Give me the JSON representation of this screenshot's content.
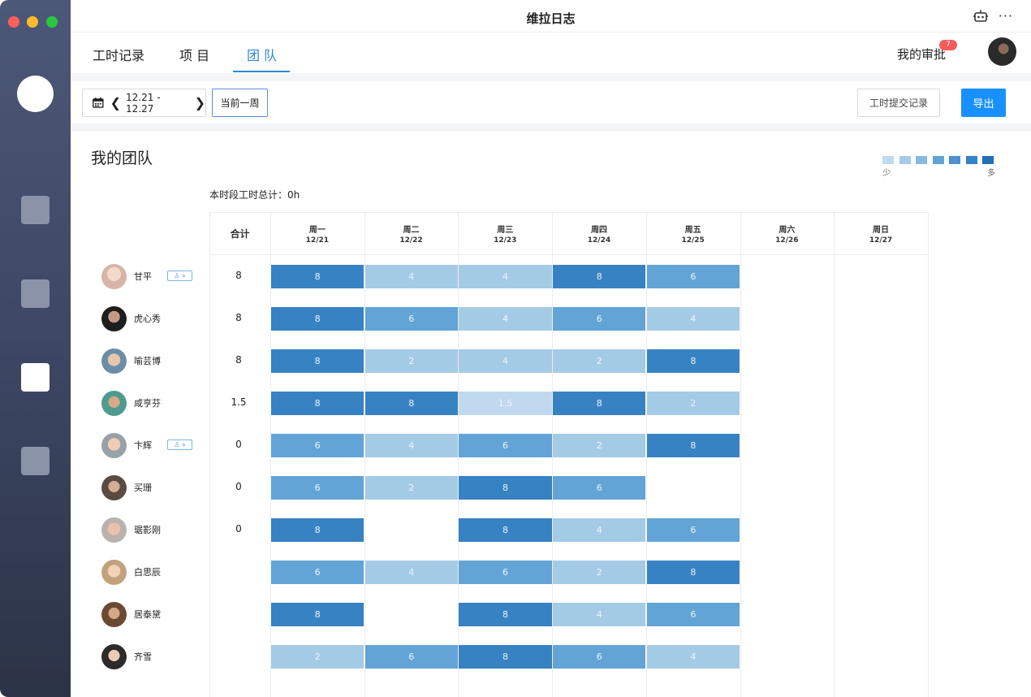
{
  "window": {
    "title": "维拉日志"
  },
  "nav": {
    "tabs": [
      {
        "label": "工时记录"
      },
      {
        "label": "项 目"
      },
      {
        "label": "团 队"
      }
    ],
    "approval_label": "我的审批",
    "approval_badge": "7"
  },
  "toolbar": {
    "date_range": "12.21 - 12.27",
    "current_week_label": "当前一周",
    "record_label": "工时提交记录",
    "export_label": "导出"
  },
  "team": {
    "title": "我的团队",
    "period_total": "本时段工时总计：0h",
    "legend": {
      "low": "少",
      "high": "多",
      "colors": [
        "#c1d9ee",
        "#a4cbe6",
        "#86bbe0",
        "#62a4d6",
        "#4b92cc",
        "#3782c2",
        "#2170b3"
      ]
    },
    "total_header": "合计",
    "days": [
      {
        "label": "周一",
        "date": "12/21"
      },
      {
        "label": "周二",
        "date": "12/22"
      },
      {
        "label": "周三",
        "date": "12/23"
      },
      {
        "label": "周四",
        "date": "12/24"
      },
      {
        "label": "周五",
        "date": "12/25"
      },
      {
        "label": "周六",
        "date": "12/26"
      },
      {
        "label": "周日",
        "date": "12/27"
      }
    ],
    "members": [
      {
        "name": "甘平",
        "total": "8",
        "tag": "♙ »",
        "hours": [
          "8",
          "4",
          "4",
          "8",
          "6",
          "",
          ""
        ]
      },
      {
        "name": "虎心秀",
        "total": "8",
        "hours": [
          "8",
          "6",
          "4",
          "6",
          "4",
          "",
          ""
        ]
      },
      {
        "name": "喻芸博",
        "total": "8",
        "hours": [
          "8",
          "2",
          "4",
          "2",
          "8",
          "",
          ""
        ]
      },
      {
        "name": "咸亨芬",
        "total": "1.5",
        "hours": [
          "8",
          "8",
          "1.5",
          "8",
          "2",
          "",
          ""
        ]
      },
      {
        "name": "卞辉",
        "total": "0",
        "tag": "♙ »",
        "hours": [
          "6",
          "4",
          "6",
          "2",
          "8",
          "",
          ""
        ]
      },
      {
        "name": "买珊",
        "total": "0",
        "hours": [
          "6",
          "2",
          "8",
          "6",
          "",
          "",
          ""
        ]
      },
      {
        "name": "琚影刚",
        "total": "0",
        "hours": [
          "8",
          "",
          "8",
          "4",
          "6",
          "",
          ""
        ]
      },
      {
        "name": "白思辰",
        "total": "",
        "hours": [
          "6",
          "4",
          "6",
          "2",
          "8",
          "",
          ""
        ]
      },
      {
        "name": "居泰黛",
        "total": "",
        "hours": [
          "8",
          "",
          "8",
          "4",
          "6",
          "",
          ""
        ]
      },
      {
        "name": "齐雪",
        "total": "",
        "hours": [
          "2",
          "6",
          "8",
          "6",
          "4",
          "",
          ""
        ]
      }
    ]
  },
  "icons": {
    "calendar": "calendar-icon",
    "prev": "chevron-left-icon",
    "next": "chevron-right-icon",
    "robot": "robot-icon",
    "more": "more-icon"
  }
}
